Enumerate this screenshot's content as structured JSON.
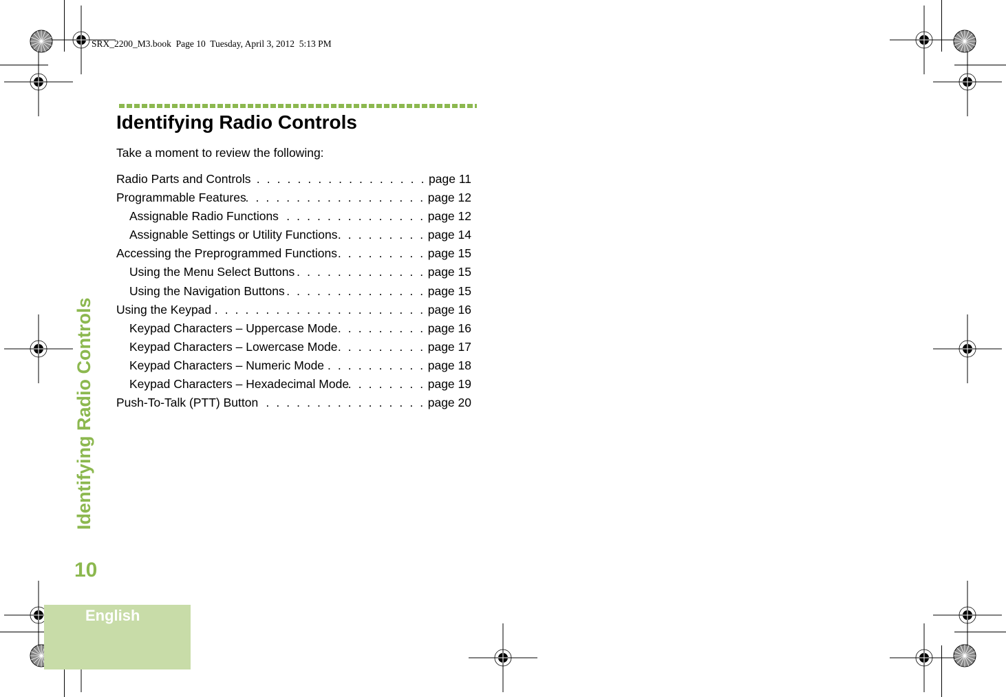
{
  "header": {
    "stamp": "SRX_2200_M3.book  Page 10  Tuesday, April 3, 2012  5:13 PM"
  },
  "section": {
    "title": "Identifying Radio Controls",
    "intro": "Take a moment to review the following:",
    "side_tab_title": "Identifying Radio Controls",
    "page_number": "10",
    "language": "English"
  },
  "toc": [
    {
      "label": "Radio Parts and Controls",
      "page": "page 11",
      "level": 1
    },
    {
      "label": "Programmable Features",
      "page": "page 12",
      "level": 1
    },
    {
      "label": "Assignable Radio Functions",
      "page": "page 12",
      "level": 2
    },
    {
      "label": "Assignable Settings or Utility Functions",
      "page": "page 14",
      "level": 2
    },
    {
      "label": "Accessing the Preprogrammed Functions",
      "page": "page 15",
      "level": 1
    },
    {
      "label": "Using the Menu Select Buttons",
      "page": "page 15",
      "level": 2
    },
    {
      "label": "Using the Navigation Buttons",
      "page": "page 15",
      "level": 2
    },
    {
      "label": "Using the Keypad",
      "page": "page 16",
      "level": 1
    },
    {
      "label": "Keypad Characters – Uppercase Mode",
      "page": "page 16",
      "level": 2
    },
    {
      "label": "Keypad Characters – Lowercase Mode",
      "page": "page 17",
      "level": 2
    },
    {
      "label": "Keypad Characters – Numeric Mode",
      "page": "page 18",
      "level": 2
    },
    {
      "label": "Keypad Characters – Hexadecimal Mode",
      "page": "page 19",
      "level": 2
    },
    {
      "label": "Push-To-Talk (PTT) Button",
      "page": "page 20",
      "level": 1
    }
  ],
  "colors": {
    "accent_green": "#8cb84f",
    "tab_green": "#c8dca8"
  },
  "dot_leader": ". . . . . . . . . . . . . . . . . . . . . . . . . . . . . . . . . . . . . . ."
}
